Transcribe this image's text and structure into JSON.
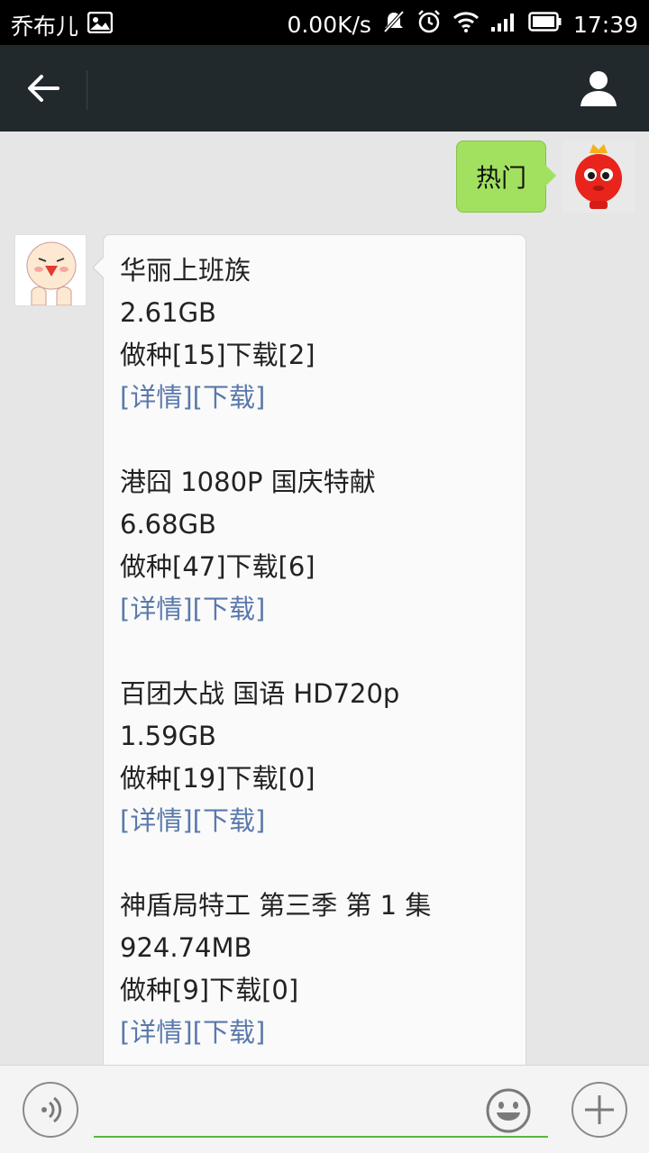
{
  "status_bar": {
    "carrier": "乔布儿",
    "network_speed": "0.00K/s",
    "time": "17:39",
    "icons": [
      "image-icon",
      "mute-icon",
      "alarm-icon",
      "wifi-icon",
      "signal-icon",
      "battery-icon"
    ]
  },
  "title_bar": {
    "back_icon": "arrow-left-icon",
    "profile_icon": "person-icon"
  },
  "messages": {
    "sent": {
      "text": "热门"
    },
    "received": {
      "entries": [
        {
          "title": "华丽上班族",
          "size": "2.61GB",
          "stats": "做种[15]下载[2]",
          "detail": "[详情]",
          "download": "[下载]"
        },
        {
          "title": "港囧 1080P 国庆特献",
          "size": "6.68GB",
          "stats": "做种[47]下载[6]",
          "detail": "[详情]",
          "download": "[下载]"
        },
        {
          "title": "百团大战 国语 HD720p",
          "size": "1.59GB",
          "stats": "做种[19]下载[0]",
          "detail": "[详情]",
          "download": "[下载]"
        },
        {
          "title": "神盾局特工 第三季 第 1 集",
          "size": "924.74MB",
          "stats": "做种[9]下载[0]",
          "detail": "[详情]",
          "download": "[下载]"
        }
      ]
    }
  },
  "input_bar": {
    "placeholder": "",
    "icons": [
      "voice-icon",
      "emoji-icon",
      "plus-icon"
    ]
  },
  "colors": {
    "title_bar": "#22292c",
    "sent_bubble": "#a1e15f",
    "link": "#5a79ab",
    "input_underline": "#57b93a"
  }
}
